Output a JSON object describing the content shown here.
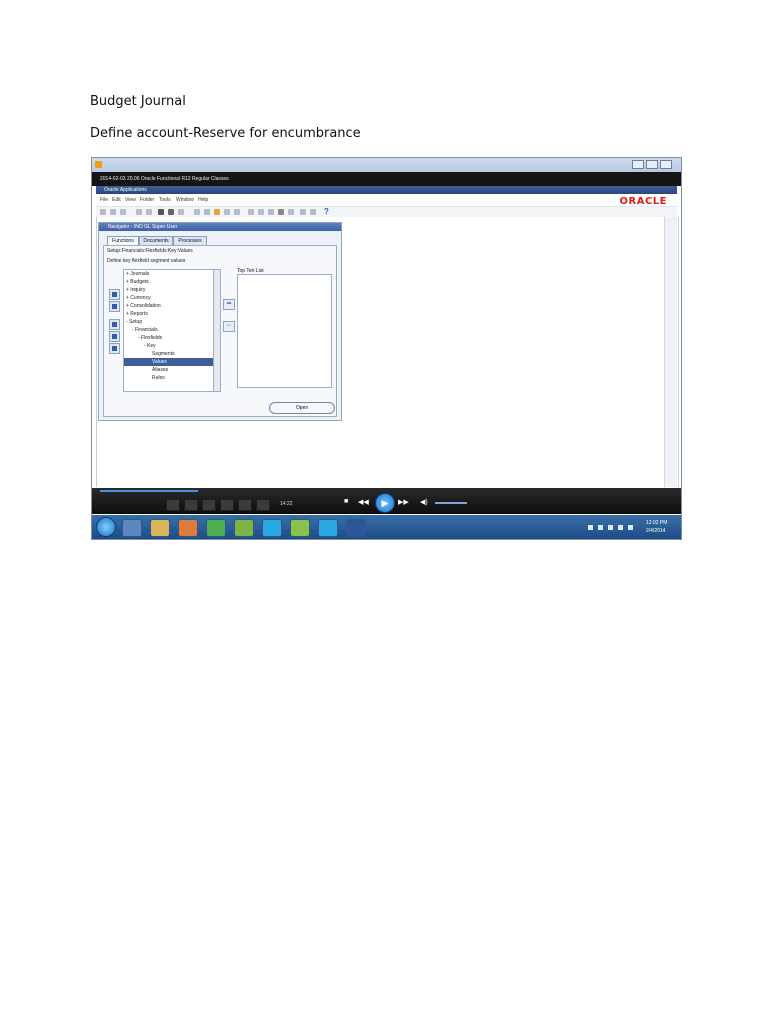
{
  "document": {
    "heading1": "Budget Journal",
    "heading2": "Define account-Reserve for encumbrance"
  },
  "screenshot": {
    "video_title": "2014-02-03 20.06 Oracle Functional R12 Regular Classes",
    "app_title": "Oracle Applications",
    "menu": [
      "File",
      "Edit",
      "View",
      "Folder",
      "Tools",
      "Window",
      "Help"
    ],
    "logo_text": "ORACLE",
    "help_glyph": "?",
    "navigator": {
      "title": "Navigator - INO GL Super User",
      "tabs": [
        "Functions",
        "Documents",
        "Processes"
      ],
      "path": "Setup:Financials:Flexfields:Key:Values",
      "description": "Define key flexfield segment values",
      "tree": [
        "+ Journals",
        "+ Budgets",
        "+ Inquiry",
        "+ Currency",
        "+ Consolidation",
        "+ Reports",
        "- Setup",
        "- Financials",
        "- Flexfields",
        "- Key",
        "Segments",
        "Values",
        "Aliases",
        "Rules"
      ],
      "selected_index": 11,
      "top_ten_label": "Top Ten List",
      "open_label": "Open",
      "add_arrow": "➡",
      "remove_arrow": "⇐"
    },
    "player": {
      "time": "14:22",
      "play_glyph": "▶",
      "back_glyph": "◀◀",
      "forward_glyph": "▶▶",
      "stop_glyph": "■",
      "volume_glyph": "◀)"
    },
    "taskbar": {
      "time": "12:02 PM",
      "date": "2/4/2014"
    }
  }
}
